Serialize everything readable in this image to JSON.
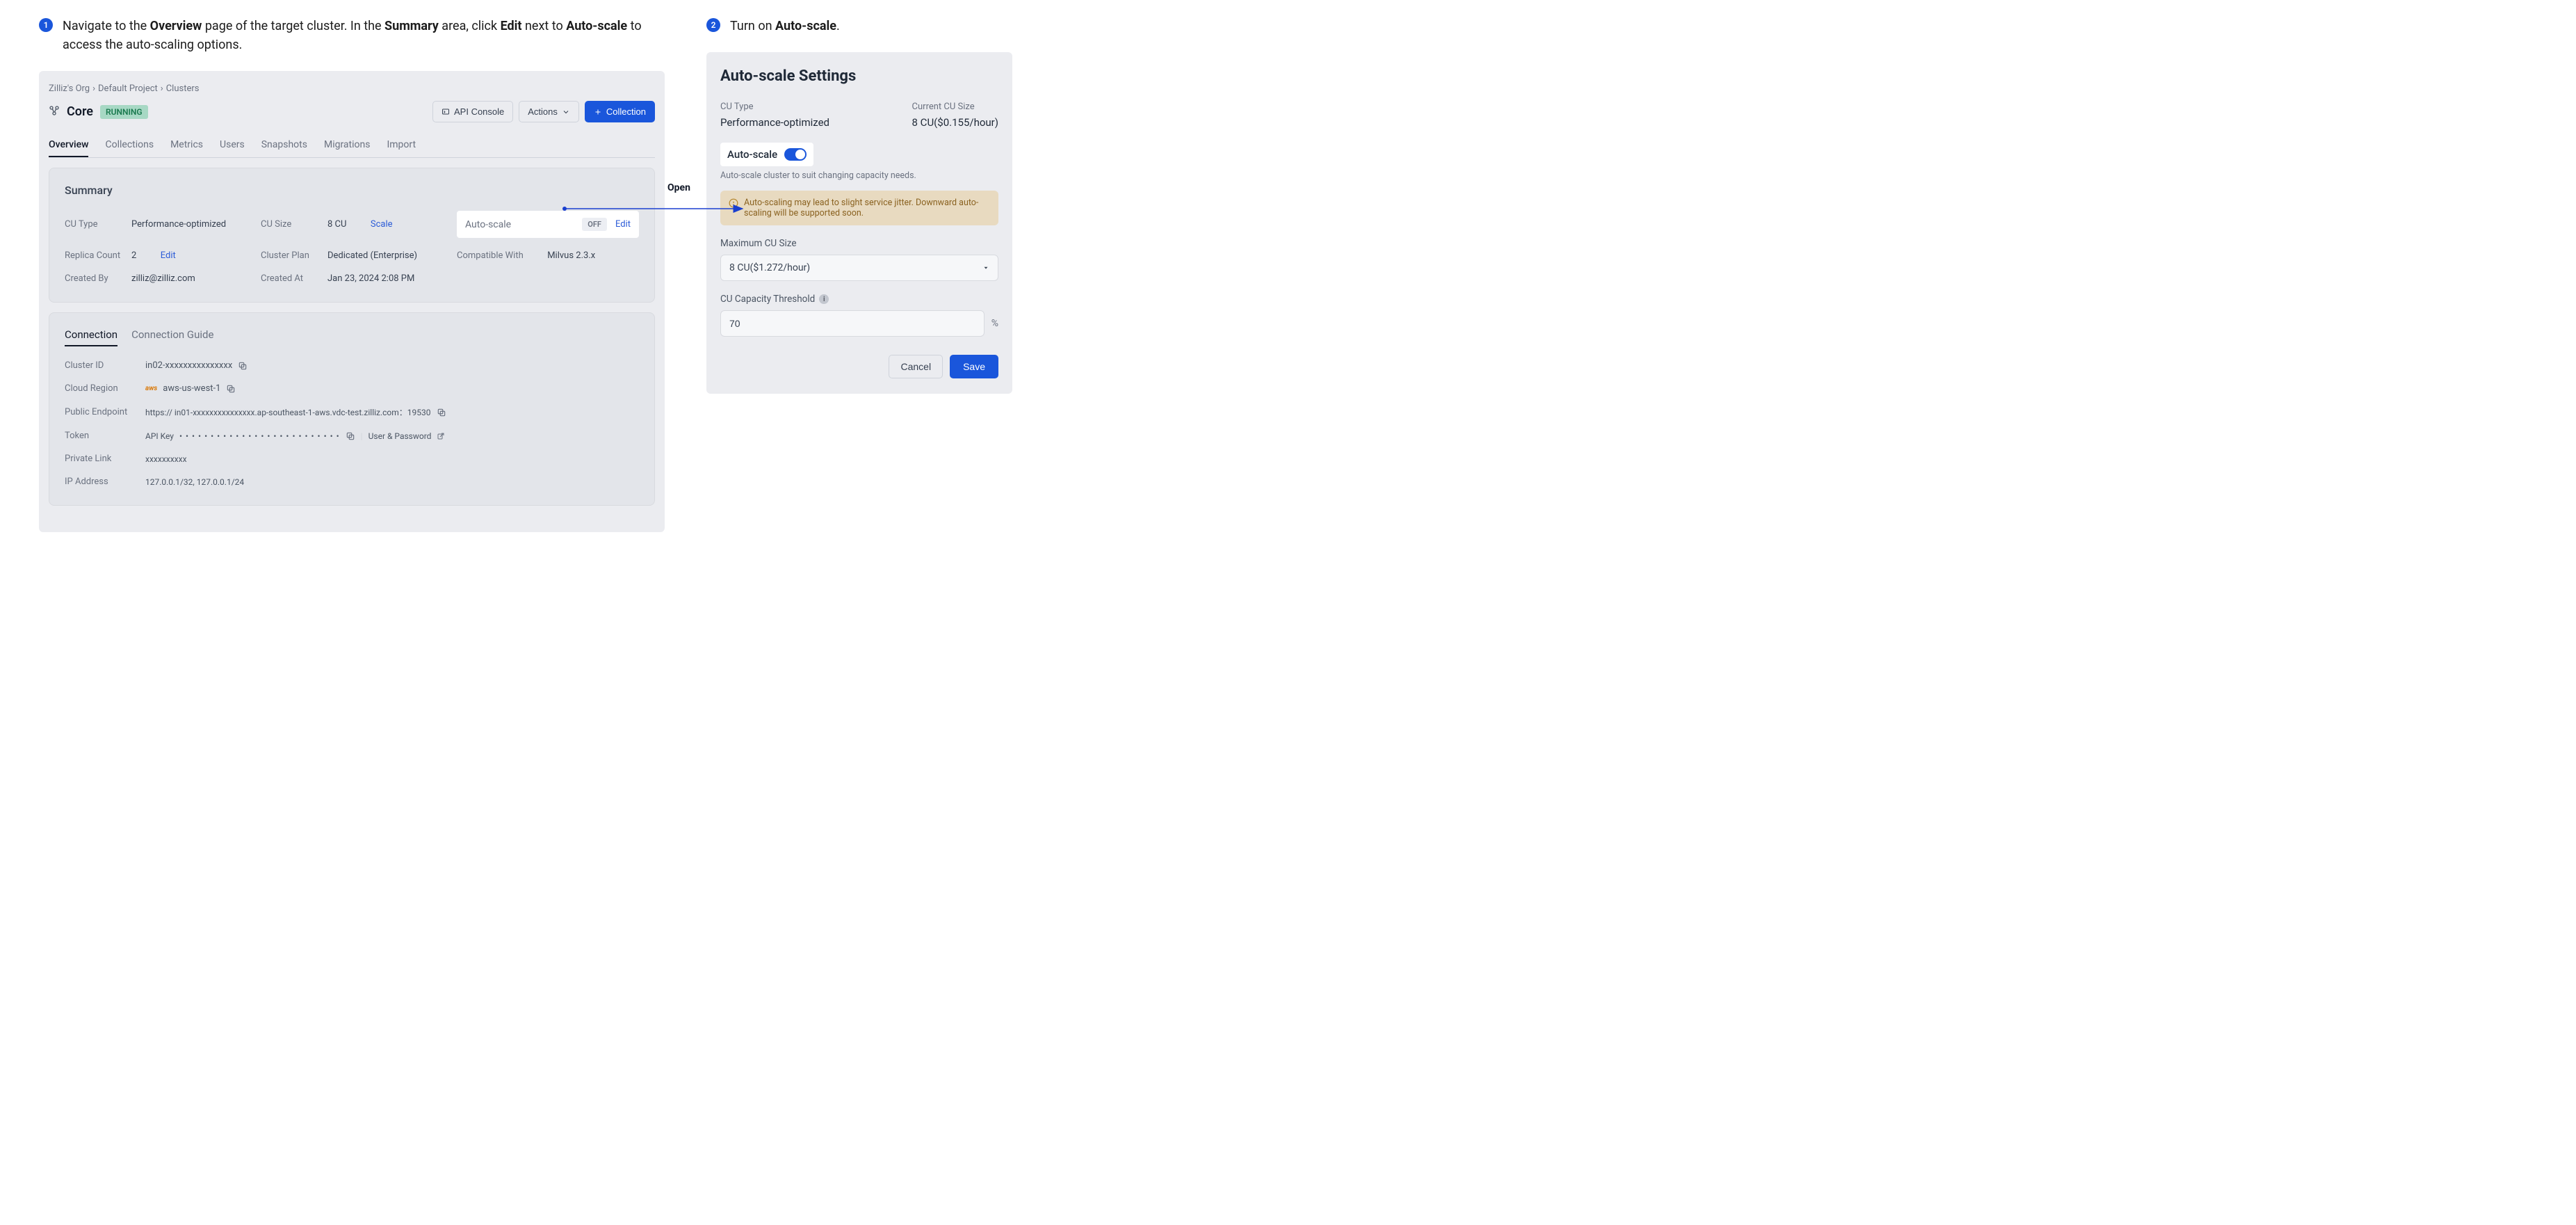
{
  "steps": {
    "one": {
      "num": "1",
      "prefix": "Navigate to the ",
      "b1": "Overview",
      "mid1": " page of the target cluster. In the ",
      "b2": "Summary",
      "mid2": " area, click ",
      "b3": "Edit",
      "mid3": " next to ",
      "b4": "Auto-scale",
      "suffix": " to access the auto-scaling options."
    },
    "two": {
      "num": "2",
      "prefix": "Turn on ",
      "b1": "Auto-scale",
      "suffix": "."
    }
  },
  "breadcrumb": {
    "a": "Zilliz's Org",
    "b": "Default Project",
    "c": "Clusters"
  },
  "cluster": {
    "name": "Core",
    "status": "RUNNING"
  },
  "headerButtons": {
    "api": "API Console",
    "actions": "Actions",
    "collection": "Collection"
  },
  "tabs": [
    "Overview",
    "Collections",
    "Metrics",
    "Users",
    "Snapshots",
    "Migrations",
    "Import"
  ],
  "summary": {
    "title": "Summary",
    "cuTypeLabel": "CU Type",
    "cuType": "Performance-optimized",
    "cuSizeLabel": "CU Size",
    "cuSize": "8 CU",
    "scaleLink": "Scale",
    "autoScaleLabel": "Auto-scale",
    "autoScaleState": "OFF",
    "editLink": "Edit",
    "replicaLabel": "Replica Count",
    "replica": "2",
    "replicaEdit": "Edit",
    "planLabel": "Cluster Plan",
    "plan": "Dedicated (Enterprise)",
    "compatLabel": "Compatible With",
    "compat": "Milvus 2.3.x",
    "createdByLabel": "Created By",
    "createdBy": "zilliz@zilliz.com",
    "createdAtLabel": "Created At",
    "createdAt": "Jan 23, 2024 2:08 PM"
  },
  "connection": {
    "tabs": [
      "Connection",
      "Connection Guide"
    ],
    "clusterIdLabel": "Cluster ID",
    "clusterId": "in02-xxxxxxxxxxxxxxx",
    "regionLabel": "Cloud Region",
    "awsBadge": "aws",
    "region": "aws-us-west-1",
    "endpointLabel": "Public Endpoint",
    "endpoint": "https:// in01-xxxxxxxxxxxxxxx.ap-southeast-1-aws.vdc-test.zilliz.com：19530",
    "tokenLabel": "Token",
    "apiKeyLabel": "API Key",
    "apiKeyMask": "• • • • • • • • • • • • • • • • • • • • • • • • • •",
    "userPass": "User & Password",
    "privateLabel": "Private Link",
    "privateLink": "xxxxxxxxxx",
    "ipLabel": "IP Address",
    "ip": "127.0.0.1/32, 127.0.0.1/24"
  },
  "openLabel": "Open",
  "settings": {
    "title": "Auto-scale Settings",
    "cuTypeLabel": "CU Type",
    "cuType": "Performance-optimized",
    "currentLabel": "Current CU Size",
    "current": "8 CU($0.155/hour)",
    "autoScaleLabel": "Auto-scale",
    "helper": "Auto-scale cluster to suit changing capacity needs.",
    "warning": "Auto-scaling may lead to slight service jitter. Downward auto-scaling will be supported soon.",
    "maxLabel": "Maximum CU Size",
    "maxValue": "8 CU($1.272/hour)",
    "thresholdLabel": "CU Capacity Threshold",
    "thresholdValue": "70",
    "pct": "%",
    "cancel": "Cancel",
    "save": "Save"
  }
}
